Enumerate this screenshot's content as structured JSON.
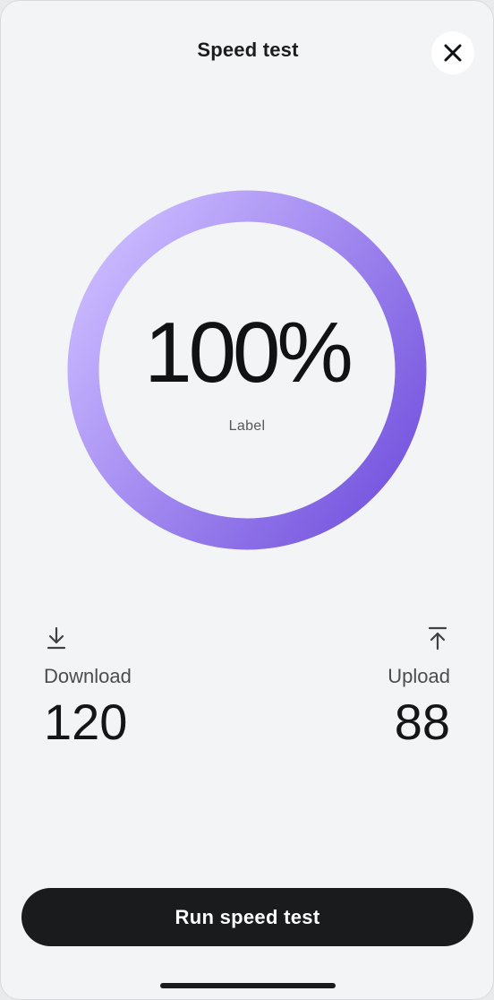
{
  "header": {
    "title": "Speed test",
    "close_icon": "close-icon"
  },
  "gauge": {
    "progress_percent": 100,
    "value_text": "100%",
    "label": "Label",
    "gradient_colors": [
      "#c9b8ff",
      "#7a5ae0"
    ]
  },
  "metrics": {
    "download": {
      "icon": "download-icon",
      "label": "Download",
      "value": "120"
    },
    "upload": {
      "icon": "upload-icon",
      "label": "Upload",
      "value": "88"
    }
  },
  "actions": {
    "run_label": "Run speed test"
  },
  "colors": {
    "background": "#f3f4f6",
    "button": "#1a1b1d",
    "text": "#1b1c1e"
  }
}
